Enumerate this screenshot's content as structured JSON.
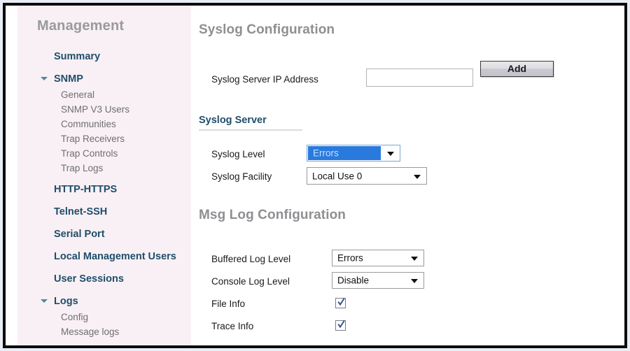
{
  "sidebar": {
    "title": "Management",
    "items": [
      {
        "label": "Summary",
        "type": "top",
        "expandable": false
      },
      {
        "label": "SNMP",
        "type": "top",
        "expandable": true
      },
      {
        "label": "General",
        "type": "sub"
      },
      {
        "label": "SNMP V3 Users",
        "type": "sub"
      },
      {
        "label": "Communities",
        "type": "sub"
      },
      {
        "label": "Trap Receivers",
        "type": "sub"
      },
      {
        "label": "Trap Controls",
        "type": "sub"
      },
      {
        "label": "Trap Logs",
        "type": "sub"
      },
      {
        "label": "HTTP-HTTPS",
        "type": "top",
        "expandable": false
      },
      {
        "label": "Telnet-SSH",
        "type": "top",
        "expandable": false
      },
      {
        "label": "Serial Port",
        "type": "top",
        "expandable": false
      },
      {
        "label": "Local Management Users",
        "type": "top",
        "expandable": false
      },
      {
        "label": "User Sessions",
        "type": "top",
        "expandable": false
      },
      {
        "label": "Logs",
        "type": "top",
        "expandable": true
      },
      {
        "label": "Config",
        "type": "sub"
      },
      {
        "label": "Message logs",
        "type": "sub"
      }
    ]
  },
  "main": {
    "syslog_heading": "Syslog Configuration",
    "syslog_server_ip_label": "Syslog Server IP Address",
    "syslog_server_ip_value": "",
    "syslog_server_ip_placeholder": "",
    "add_button_label": "Add",
    "syslog_server_section": "Syslog Server",
    "syslog_level_label": "Syslog Level",
    "syslog_level_value": "Errors",
    "syslog_facility_label": "Syslog Facility",
    "syslog_facility_value": "Local Use 0",
    "msglog_heading": "Msg Log Configuration",
    "buffered_log_level_label": "Buffered Log Level",
    "buffered_log_level_value": "Errors",
    "console_log_level_label": "Console Log Level",
    "console_log_level_value": "Disable",
    "file_info_label": "File Info",
    "file_info_checked": true,
    "trace_info_label": "Trace Info",
    "trace_info_checked": true
  },
  "colors": {
    "sidebar_background": "#f8f0f4",
    "nav_link": "#1f4e6b",
    "nav_sublink": "#6e6e72",
    "heading_grey": "#8f8f93",
    "select_focus_blue": "#2a7ade",
    "checkbox_tick": "#2b4f8f",
    "frame_border": "#0c0c0c"
  }
}
